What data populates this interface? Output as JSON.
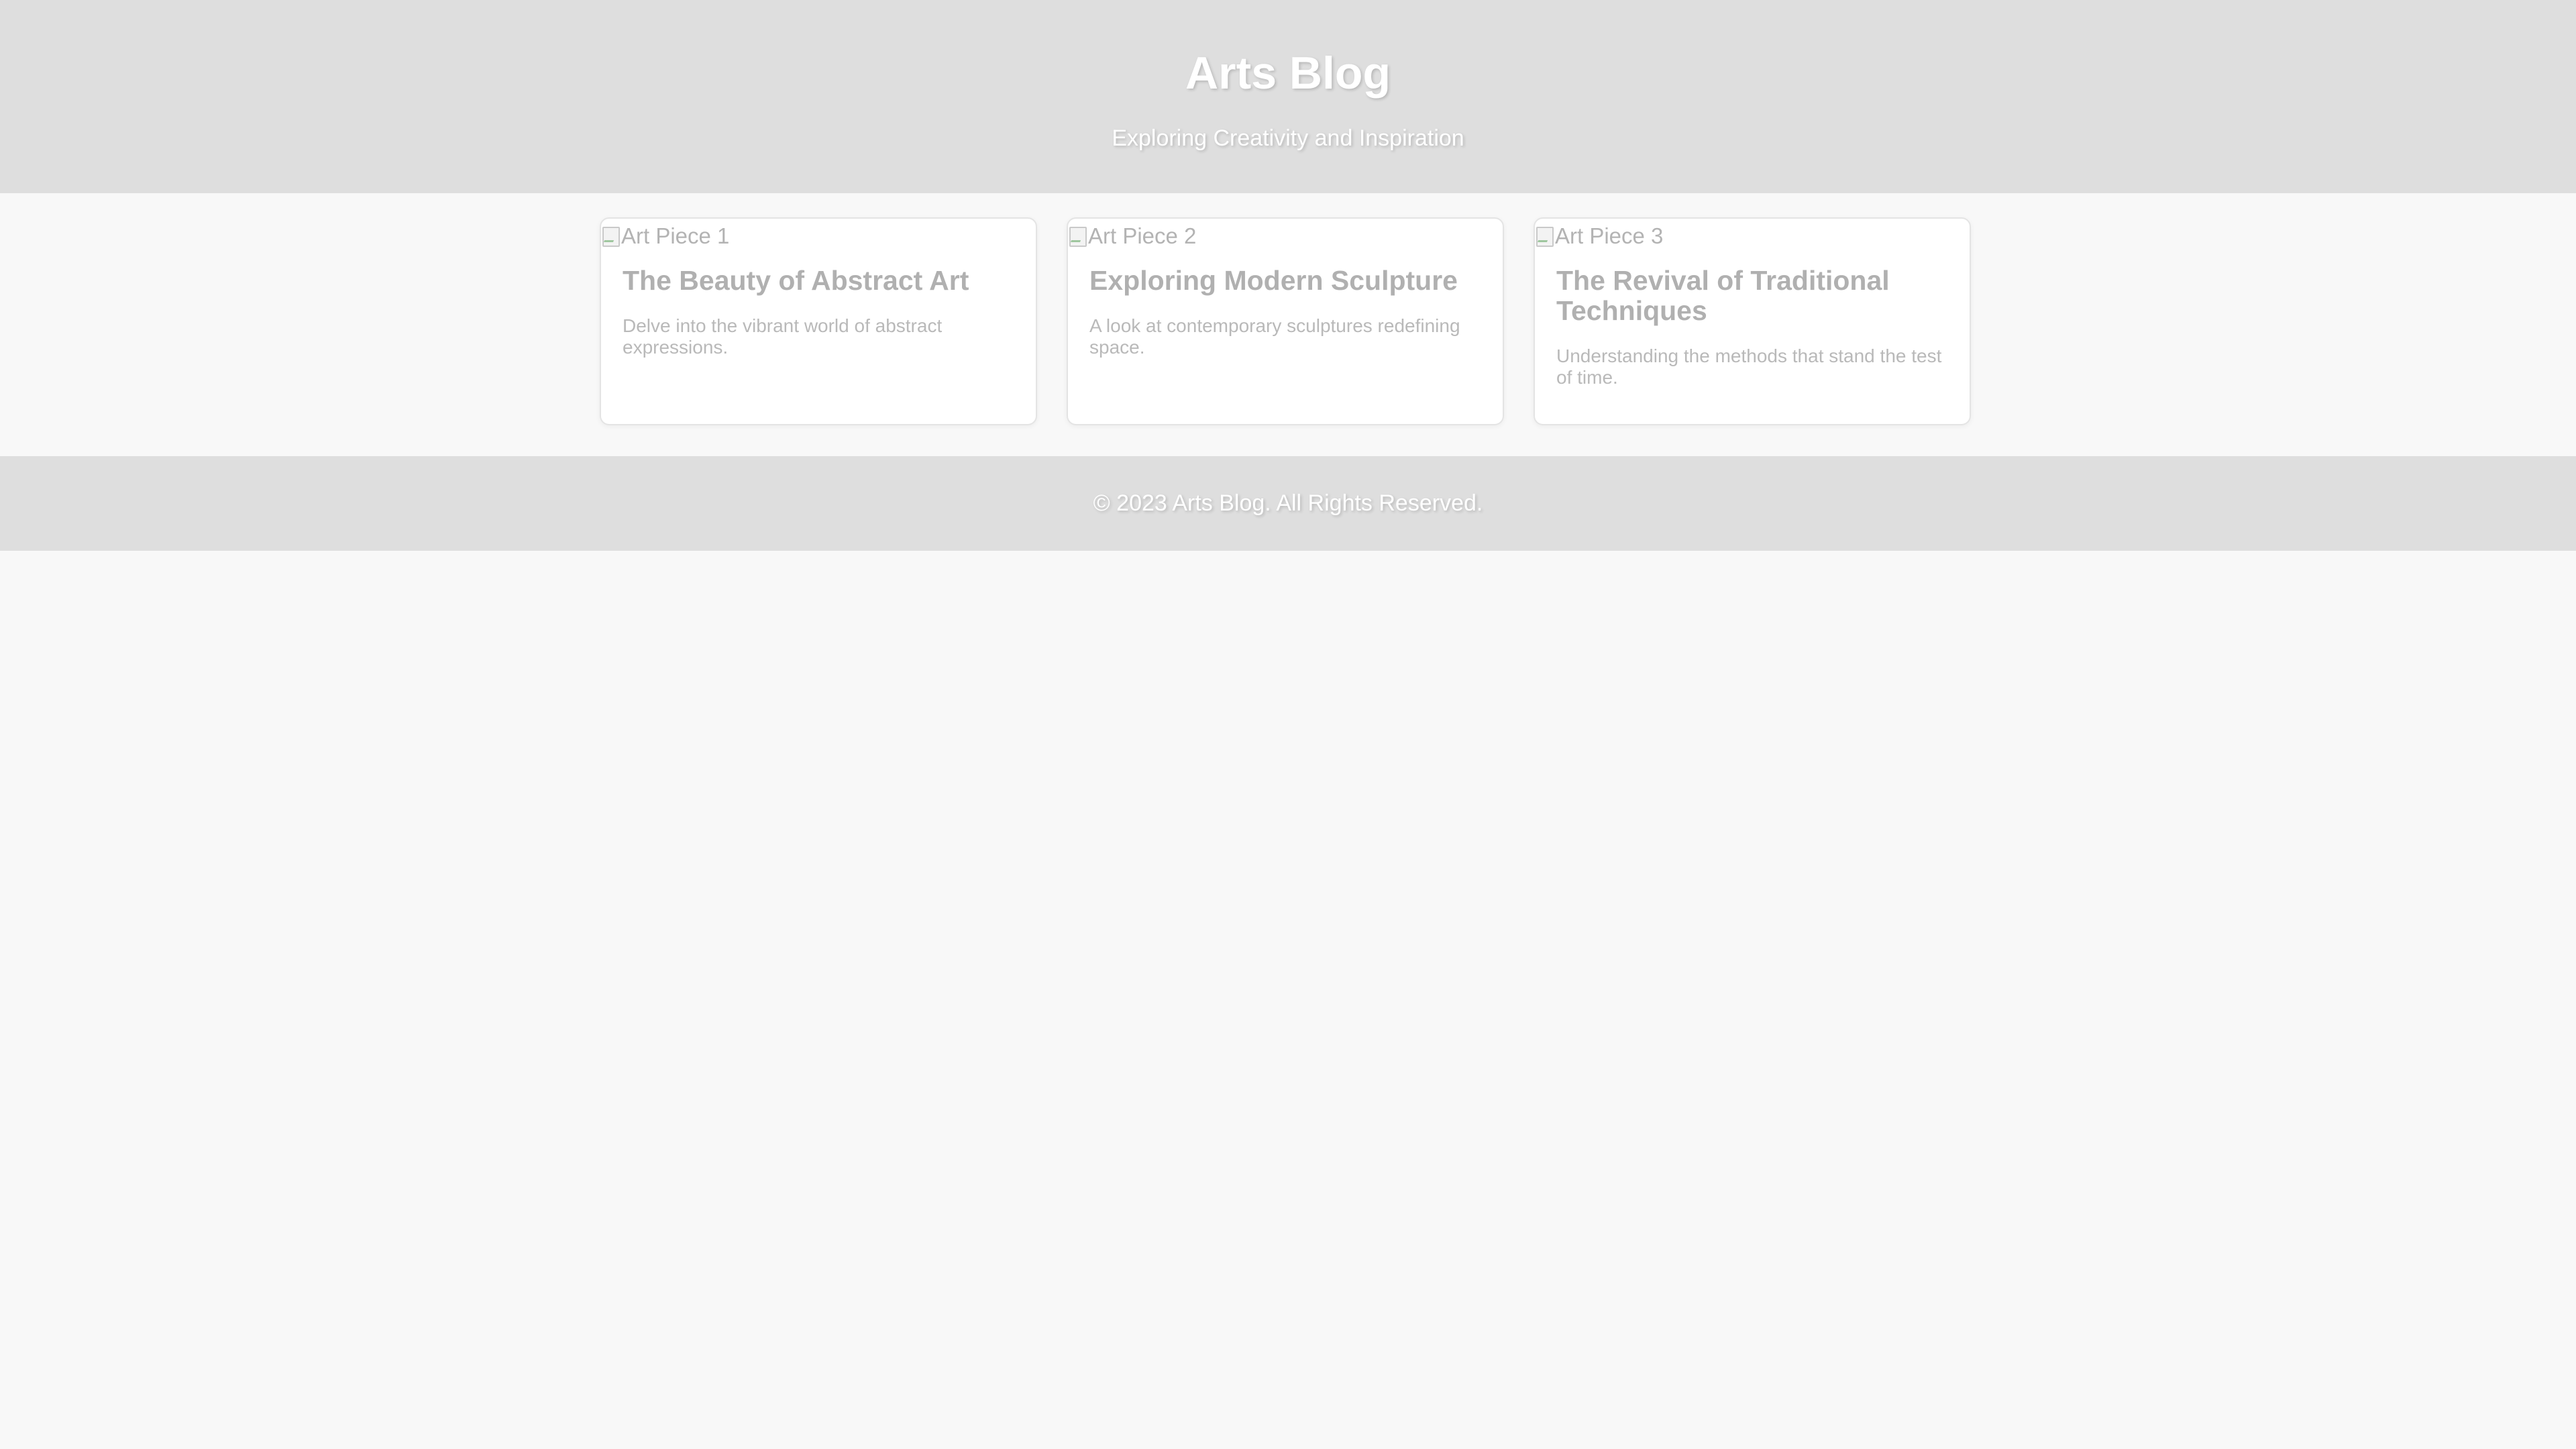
{
  "header": {
    "title": "Arts Blog",
    "tagline": "Exploring Creativity and Inspiration"
  },
  "posts": [
    {
      "image_alt": "Art Piece 1",
      "title": "The Beauty of Abstract Art",
      "description": "Delve into the vibrant world of abstract expressions."
    },
    {
      "image_alt": "Art Piece 2",
      "title": "Exploring Modern Sculpture",
      "description": "A look at contemporary sculptures redefining space."
    },
    {
      "image_alt": "Art Piece 3",
      "title": "The Revival of Traditional Techniques",
      "description": "Understanding the methods that stand the test of time."
    }
  ],
  "footer": {
    "copyright": "© 2023 Arts Blog. All Rights Reserved."
  },
  "colors": {
    "header_bg": "#dedede",
    "page_bg": "#f8f8f8",
    "card_bg": "#ffffff",
    "title_text": "#b0b0b0",
    "header_text": "#ffffff"
  }
}
